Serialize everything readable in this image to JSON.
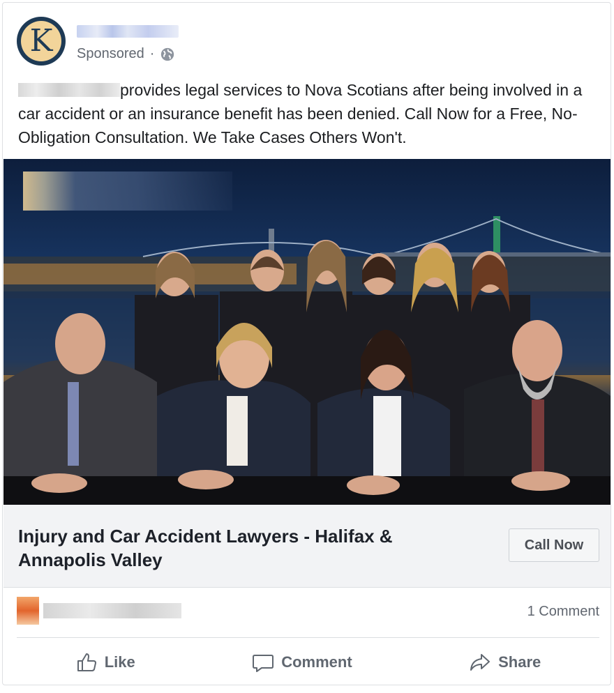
{
  "post": {
    "sponsored_label": "Sponsored",
    "separator": "·",
    "text": "provides legal services to Nova Scotians after being involved in a car accident or an insurance benefit has been denied. Call Now for a Free, No-Obligation Consultation. We Take Cases Others Won't.",
    "avatar_letter": "K"
  },
  "link_preview": {
    "headline": "Injury and Car Accident Lawyers - Halifax & Annapolis Valley",
    "cta_label": "Call Now"
  },
  "engagement": {
    "comment_count": "1 Comment"
  },
  "actions": {
    "like": "Like",
    "comment": "Comment",
    "share": "Share"
  },
  "colors": {
    "brand_navy": "#1e3a55",
    "brand_gold": "#f2d49a",
    "action_gray": "#606770"
  }
}
